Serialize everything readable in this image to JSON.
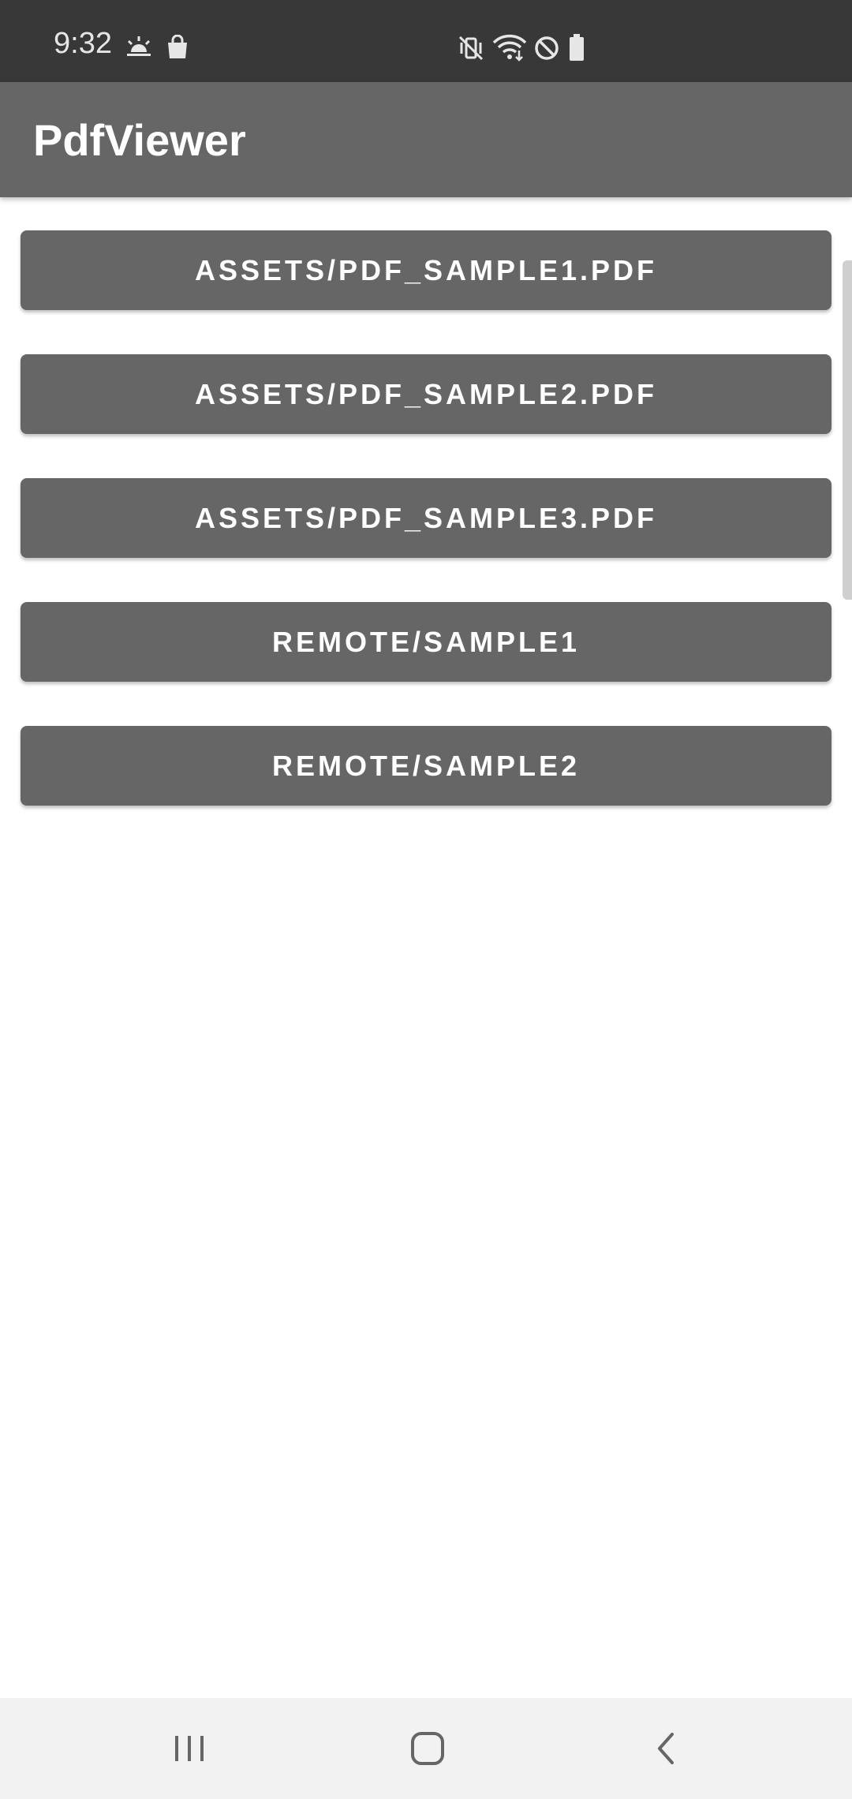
{
  "status_bar": {
    "time": "9:32",
    "left_icons": [
      "weather-sunrise-icon",
      "shopping-bag-icon"
    ],
    "right_icons": [
      "vibrate-mute-icon",
      "wifi-icon",
      "do-not-disturb-icon",
      "battery-icon"
    ]
  },
  "app_bar": {
    "title": "PdfViewer"
  },
  "buttons": [
    {
      "label": "ASSETS/PDF_SAMPLE1.PDF"
    },
    {
      "label": "ASSETS/PDF_SAMPLE2.PDF"
    },
    {
      "label": "ASSETS/PDF_SAMPLE3.PDF"
    },
    {
      "label": "REMOTE/SAMPLE1"
    },
    {
      "label": "REMOTE/SAMPLE2"
    }
  ],
  "nav_bar": {
    "icons": [
      "recent-apps-icon",
      "home-icon",
      "back-icon"
    ]
  },
  "colors": {
    "status_bar": "#383838",
    "app_bar": "#666666",
    "button": "#666666",
    "nav_bar": "#f2f2f2"
  }
}
